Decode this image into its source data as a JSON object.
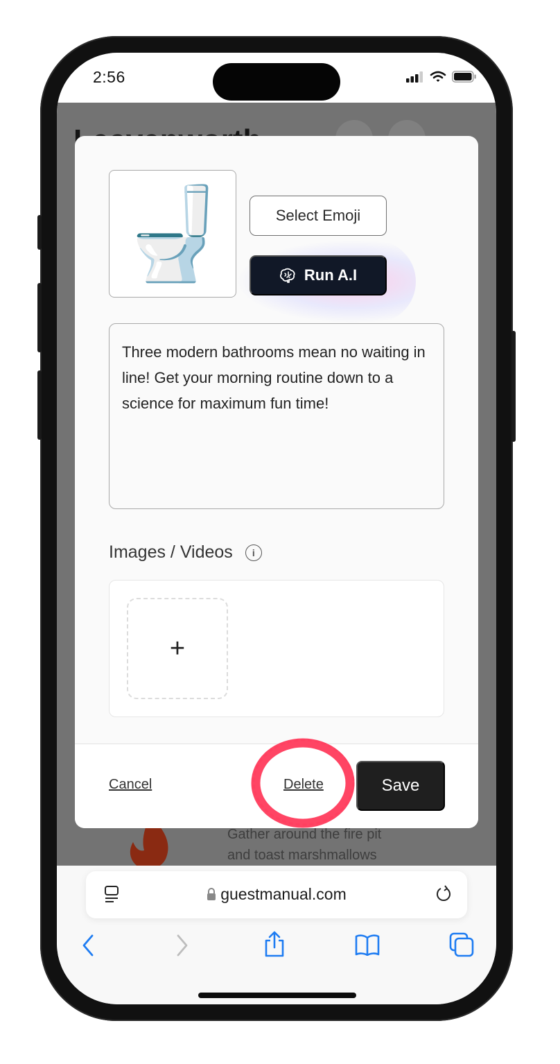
{
  "status_bar": {
    "time": "2:56",
    "icons": [
      "signal-icon",
      "wifi-icon",
      "battery-icon"
    ]
  },
  "background_page": {
    "title": "Leavenworth",
    "item_text_line1": "Gather around the fire pit",
    "item_text_line2": "and toast marshmallows",
    "item_icon": "fire-icon"
  },
  "modal": {
    "emoji": "🚽",
    "select_emoji_label": "Select Emoji",
    "run_ai_label": "Run A.I",
    "run_ai_icon": "brain-icon",
    "description": "Three modern bathrooms mean no waiting in line! Get your morning routine down to a science for maximum fun time!",
    "media_label": "Images / Videos",
    "add_media_symbol": "+",
    "footer": {
      "cancel_label": "Cancel",
      "delete_label": "Delete",
      "save_label": "Save"
    },
    "highlight_color": "#ff3b5c"
  },
  "browser": {
    "url": "guestmanual.com",
    "nav": [
      "back-icon",
      "forward-icon",
      "share-icon",
      "bookmarks-icon",
      "tabs-icon"
    ],
    "accent_color": "#1e7cf2"
  }
}
